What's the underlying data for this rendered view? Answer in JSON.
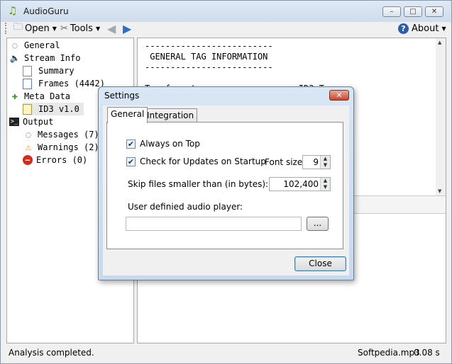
{
  "window": {
    "title": "AudioGuru",
    "app_icon": "music-note-icon"
  },
  "toolbar": {
    "open": "Open",
    "tools": "Tools",
    "about": "About"
  },
  "tree": {
    "general": "General",
    "stream_info": "Stream Info",
    "summary": "Summary",
    "frames": "Frames (4442)",
    "meta_data": "Meta Data",
    "id3": "ID3 v1.0",
    "output": "Output",
    "messages": "Messages (7)",
    "warnings": "Warnings (2)",
    "errors": "Errors (0)"
  },
  "content": {
    "text": "-------------------------\n GENERAL TAG INFORMATION\n-------------------------\n\nTag format                 :  ID3 Tag"
  },
  "status": {
    "message": "Analysis completed.",
    "file": "Softpedia.mp3",
    "time": "0.08 s"
  },
  "dialog": {
    "title": "Settings",
    "tabs": [
      "General",
      "Integration"
    ],
    "always_on_top": "Always on Top",
    "check_updates": "Check for Updates on Startup",
    "font_size_label": "Font size:",
    "font_size_value": "9",
    "skip_label": "Skip files smaller than (in bytes):",
    "skip_value": "102,400",
    "player_label": "User definied audio player:",
    "player_value": "",
    "browse": "...",
    "close": "Close"
  }
}
